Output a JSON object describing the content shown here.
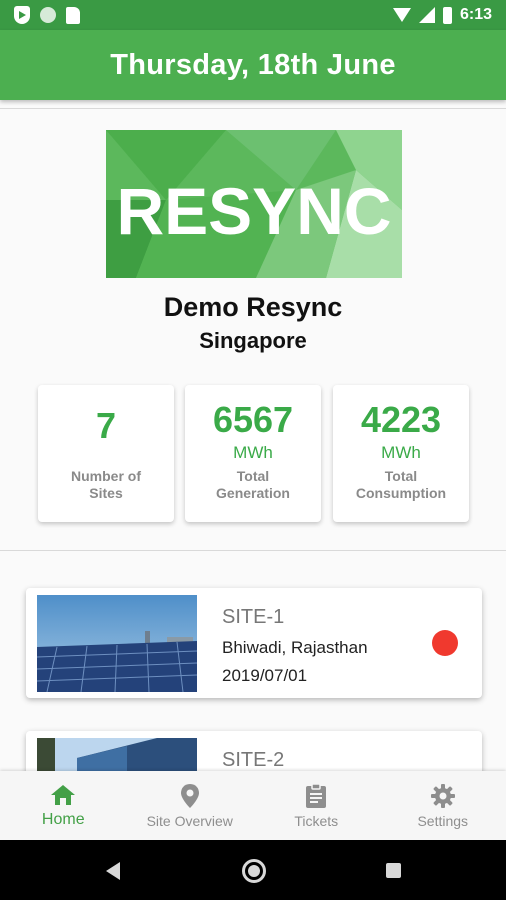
{
  "status_bar": {
    "time": "6:13",
    "icons": [
      "shield-play-icon",
      "circle-icon",
      "sd-card-icon",
      "wifi-icon",
      "signal-icon",
      "battery-icon"
    ]
  },
  "header": {
    "title": "Thursday, 18th June"
  },
  "company": {
    "logo_text": "RESYNC",
    "name": "Demo Resync",
    "location": "Singapore"
  },
  "stats": [
    {
      "value": "7",
      "unit": "",
      "label_line1": "Number of",
      "label_line2": "Sites"
    },
    {
      "value": "6567",
      "unit": "MWh",
      "label_line1": "Total",
      "label_line2": "Generation"
    },
    {
      "value": "4223",
      "unit": "MWh",
      "label_line1": "Total",
      "label_line2": "Consumption"
    }
  ],
  "sites": [
    {
      "name": "SITE-1",
      "location": "Bhiwadi, Rajasthan",
      "date": "2019/07/01",
      "status_color": "#f0392e"
    },
    {
      "name": "SITE-2",
      "location": "",
      "date": "",
      "status_color": "#3aaa48"
    }
  ],
  "bottom_nav": [
    {
      "label": "Home",
      "icon": "home-icon",
      "active": true
    },
    {
      "label": "Site Overview",
      "icon": "location-pin-icon",
      "active": false
    },
    {
      "label": "Tickets",
      "icon": "clipboard-icon",
      "active": false
    },
    {
      "label": "Settings",
      "icon": "gear-icon",
      "active": false
    }
  ],
  "colors": {
    "primary": "#4caf50",
    "status_bar": "#3a9a44",
    "accent_text": "#3aaa48",
    "alert": "#f0392e"
  }
}
